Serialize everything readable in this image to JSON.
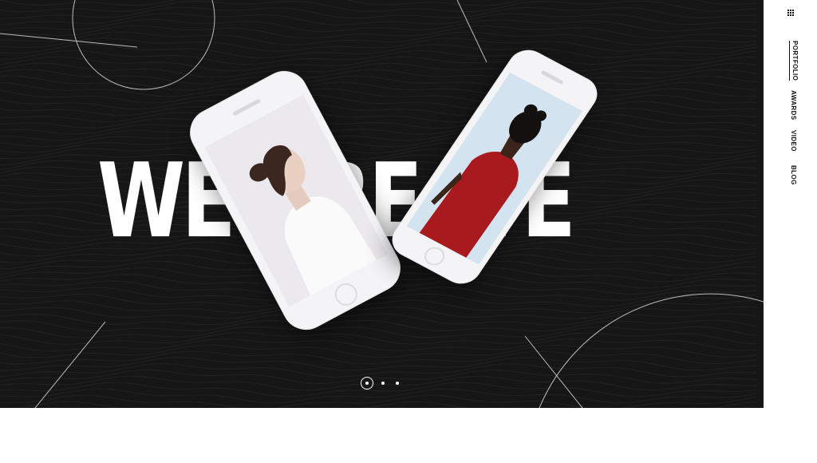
{
  "hero": {
    "headline": "WE CREATE",
    "background_color": "#161616",
    "accent_color": "#ffffff"
  },
  "slider": {
    "current_slide": 1,
    "total_slides": 3
  },
  "sidenav": {
    "menu_icon": "grid-icon",
    "items": [
      {
        "label": "PORTFOLIO",
        "active": true
      },
      {
        "label": "AWARDS",
        "active": false
      },
      {
        "label": "VIDEO",
        "active": false
      },
      {
        "label": "BLOG",
        "active": false
      }
    ]
  }
}
